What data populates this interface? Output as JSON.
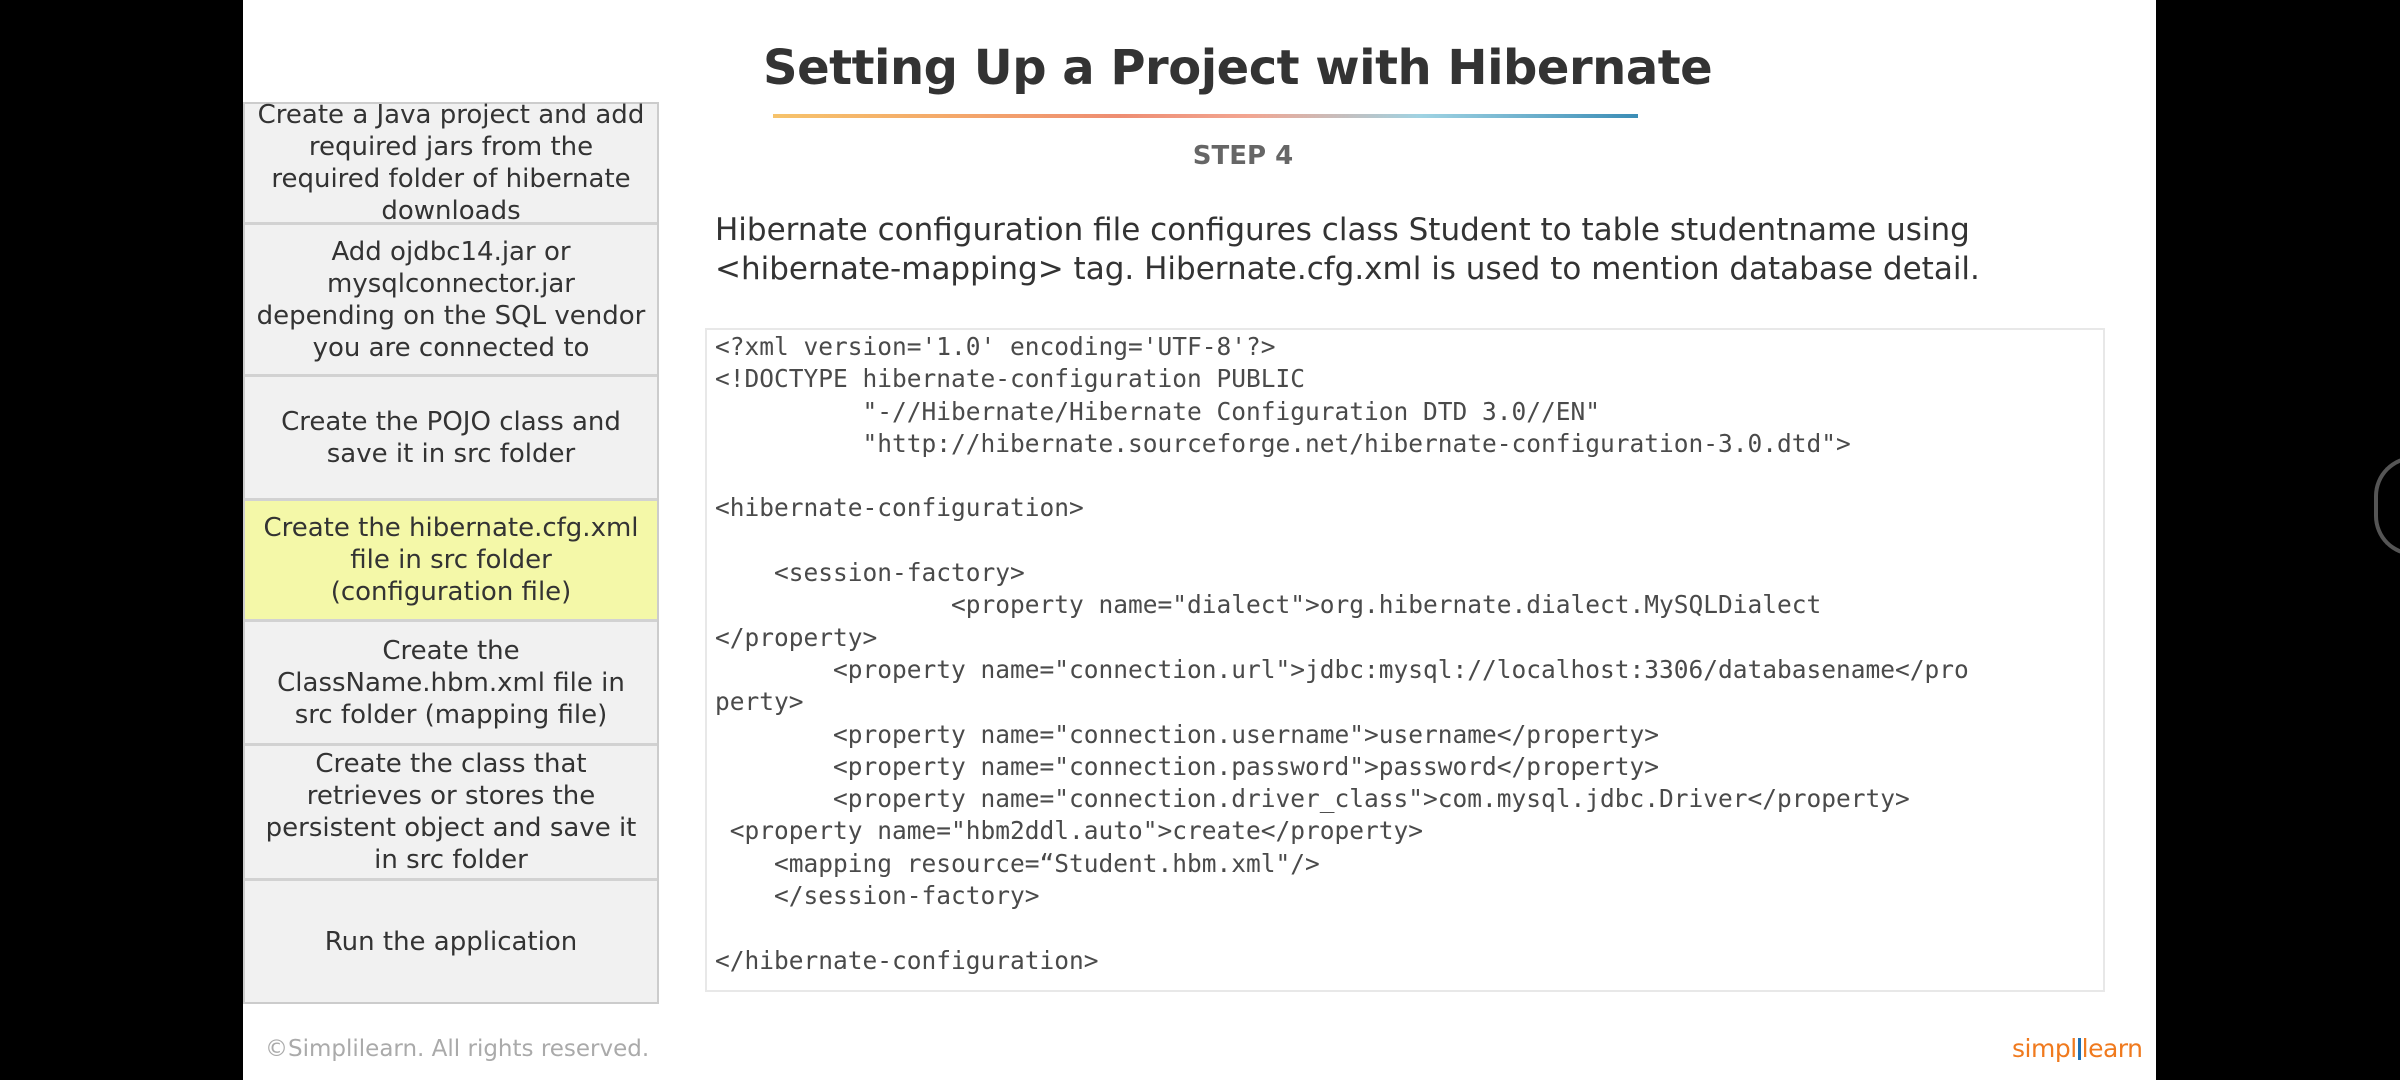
{
  "title": "Setting Up a Project with Hibernate",
  "step_label": "STEP 4",
  "description": "Hibernate configuration file configures class Student to table studentname using <hibernate-mapping> tag. Hibernate.cfg.xml is used to mention database detail.",
  "steps": [
    {
      "label": "Create a Java project and add required jars from the required folder of hibernate downloads",
      "active": false
    },
    {
      "label": "Add ojdbc14.jar or mysqlconnector.jar depending on the SQL vendor you are connected to",
      "active": false
    },
    {
      "label": "Create the POJO class and save it in src folder",
      "active": false
    },
    {
      "label": "Create the hibernate.cfg.xml file in src folder (configuration file)",
      "active": true
    },
    {
      "label": "Create the ClassName.hbm.xml  file in src folder (mapping file)",
      "active": false
    },
    {
      "label": "Create the class that retrieves or stores the persistent object and save it in src folder",
      "active": false
    },
    {
      "label": "Run the application",
      "active": false
    }
  ],
  "code_lines": [
    "<?xml version='1.0' encoding='UTF-8'?>",
    "<!DOCTYPE hibernate-configuration PUBLIC",
    "          \"-//Hibernate/Hibernate Configuration DTD 3.0//EN\"",
    "          \"http://hibernate.sourceforge.net/hibernate-configuration-3.0.dtd\">",
    "",
    "<hibernate-configuration>",
    "",
    "    <session-factory>",
    "                <property name=\"dialect\">org.hibernate.dialect.MySQLDialect",
    "</property>",
    "        <property name=\"connection.url\">jdbc:mysql://localhost:3306/databasename</pro",
    "perty>",
    "        <property name=\"connection.username\">username</property>",
    "        <property name=\"connection.password\">password</property>",
    "        <property name=\"connection.driver_class\">com.mysql.jdbc.Driver</property>",
    " <property name=\"hbm2ddl.auto\">create</property>",
    "    <mapping resource=“Student.hbm.xml\"/>",
    "    </session-factory>",
    "",
    "</hibernate-configuration>"
  ],
  "footer": {
    "copyright": "©Simplilearn. All rights reserved.",
    "brand_left": "simpl",
    "brand_right": "learn"
  },
  "colors": {
    "active_step": "#f4f8a8",
    "step_bg": "#f1f1f1",
    "brand_orange": "#f07a1e",
    "brand_blue": "#1f6fb2"
  }
}
